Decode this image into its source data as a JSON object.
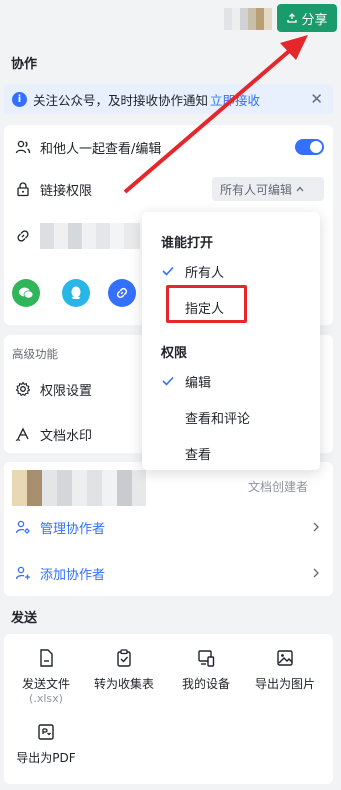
{
  "header": {
    "share_label": "分享"
  },
  "collab": {
    "title": "协作",
    "notice_text": "关注公众号，及时接收协作通知",
    "notice_link": "立即接收",
    "view_together_label": "和他人一起查看/编辑",
    "link_perm_label": "链接权限",
    "link_perm_value": "所有人可编辑"
  },
  "dropdown": {
    "open_title": "谁能打开",
    "open_options": [
      "所有人",
      "指定人"
    ],
    "perm_title": "权限",
    "perm_options": [
      "编辑",
      "查看和评论",
      "查看"
    ]
  },
  "advanced": {
    "title": "高级功能",
    "perm_settings_label": "权限设置",
    "watermark_label": "文档水印"
  },
  "creator": {
    "role_label": "文档创建者",
    "manage_label": "管理协作者",
    "add_label": "添加协作者"
  },
  "send": {
    "title": "发送",
    "items": [
      {
        "label": "发送文件",
        "sub": "(.xlsx)"
      },
      {
        "label": "转为收集表"
      },
      {
        "label": "我的设备"
      },
      {
        "label": "导出为图片"
      },
      {
        "label": "导出为PDF"
      }
    ]
  },
  "colors": {
    "accent": "#3370ff",
    "share_green": "#1a9b6b",
    "annotation_red": "#e5262b"
  }
}
